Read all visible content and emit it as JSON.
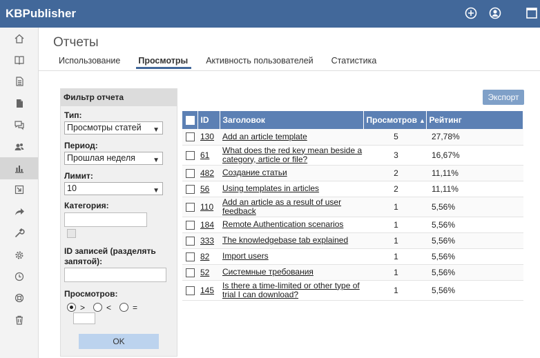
{
  "app": {
    "brand": "KBPublisher"
  },
  "topbar": {
    "icons": [
      "plus-circle-icon",
      "user-circle-icon",
      "window-icon"
    ]
  },
  "sidebar": {
    "items": [
      {
        "icon": "home-icon"
      },
      {
        "icon": "book-icon"
      },
      {
        "icon": "document-icon"
      },
      {
        "icon": "file-icon"
      },
      {
        "icon": "chat-icon"
      },
      {
        "icon": "users-icon"
      },
      {
        "icon": "bar-chart-icon",
        "active": true
      },
      {
        "icon": "import-icon"
      },
      {
        "icon": "share-icon"
      },
      {
        "icon": "wrench-icon"
      },
      {
        "icon": "gear-icon"
      },
      {
        "icon": "clock-icon"
      },
      {
        "icon": "lifebuoy-icon"
      },
      {
        "icon": "trash-icon"
      }
    ]
  },
  "page": {
    "title": "Отчеты"
  },
  "tabs": [
    {
      "label": "Использование"
    },
    {
      "label": "Просмотры",
      "active": true
    },
    {
      "label": "Активность пользователей"
    },
    {
      "label": "Статистика"
    }
  ],
  "filter": {
    "title": "Фильтр отчета",
    "type_label": "Тип:",
    "type_value": "Просмотры статей",
    "period_label": "Период:",
    "period_value": "Прошлая неделя",
    "limit_label": "Лимит:",
    "limit_value": "10",
    "category_label": "Категория:",
    "category_value": "",
    "ids_label": "ID записей (разделять запятой):",
    "ids_value": "",
    "views_label": "Просмотров:",
    "op_gt": ">",
    "op_lt": "<",
    "op_eq": "=",
    "views_value": "",
    "ok_label": "OK"
  },
  "export_label": "Экспорт",
  "table": {
    "headers": {
      "id": "ID",
      "title": "Заголовок",
      "views": "Просмотров",
      "rating": "Рейтинг"
    },
    "rows": [
      {
        "id": "130",
        "title": "Add an article template",
        "views": "5",
        "rating": "27,78%"
      },
      {
        "id": "61",
        "title": "What does the red key mean beside a category, article or file?",
        "views": "3",
        "rating": "16,67%"
      },
      {
        "id": "482",
        "title": "Создание статьи",
        "views": "2",
        "rating": "11,11%"
      },
      {
        "id": "56",
        "title": "Using templates in articles",
        "views": "2",
        "rating": "11,11%"
      },
      {
        "id": "110",
        "title": "Add an article as a result of user feedback",
        "views": "1",
        "rating": "5,56%"
      },
      {
        "id": "184",
        "title": "Remote Authentication scenarios",
        "views": "1",
        "rating": "5,56%"
      },
      {
        "id": "333",
        "title": "The knowledgebase tab explained",
        "views": "1",
        "rating": "5,56%"
      },
      {
        "id": "82",
        "title": "Import users",
        "views": "1",
        "rating": "5,56%"
      },
      {
        "id": "52",
        "title": "Системные требования",
        "views": "1",
        "rating": "5,56%"
      },
      {
        "id": "145",
        "title": "Is there a time-limited or other type of trial I can download?",
        "views": "1",
        "rating": "5,56%"
      }
    ]
  }
}
